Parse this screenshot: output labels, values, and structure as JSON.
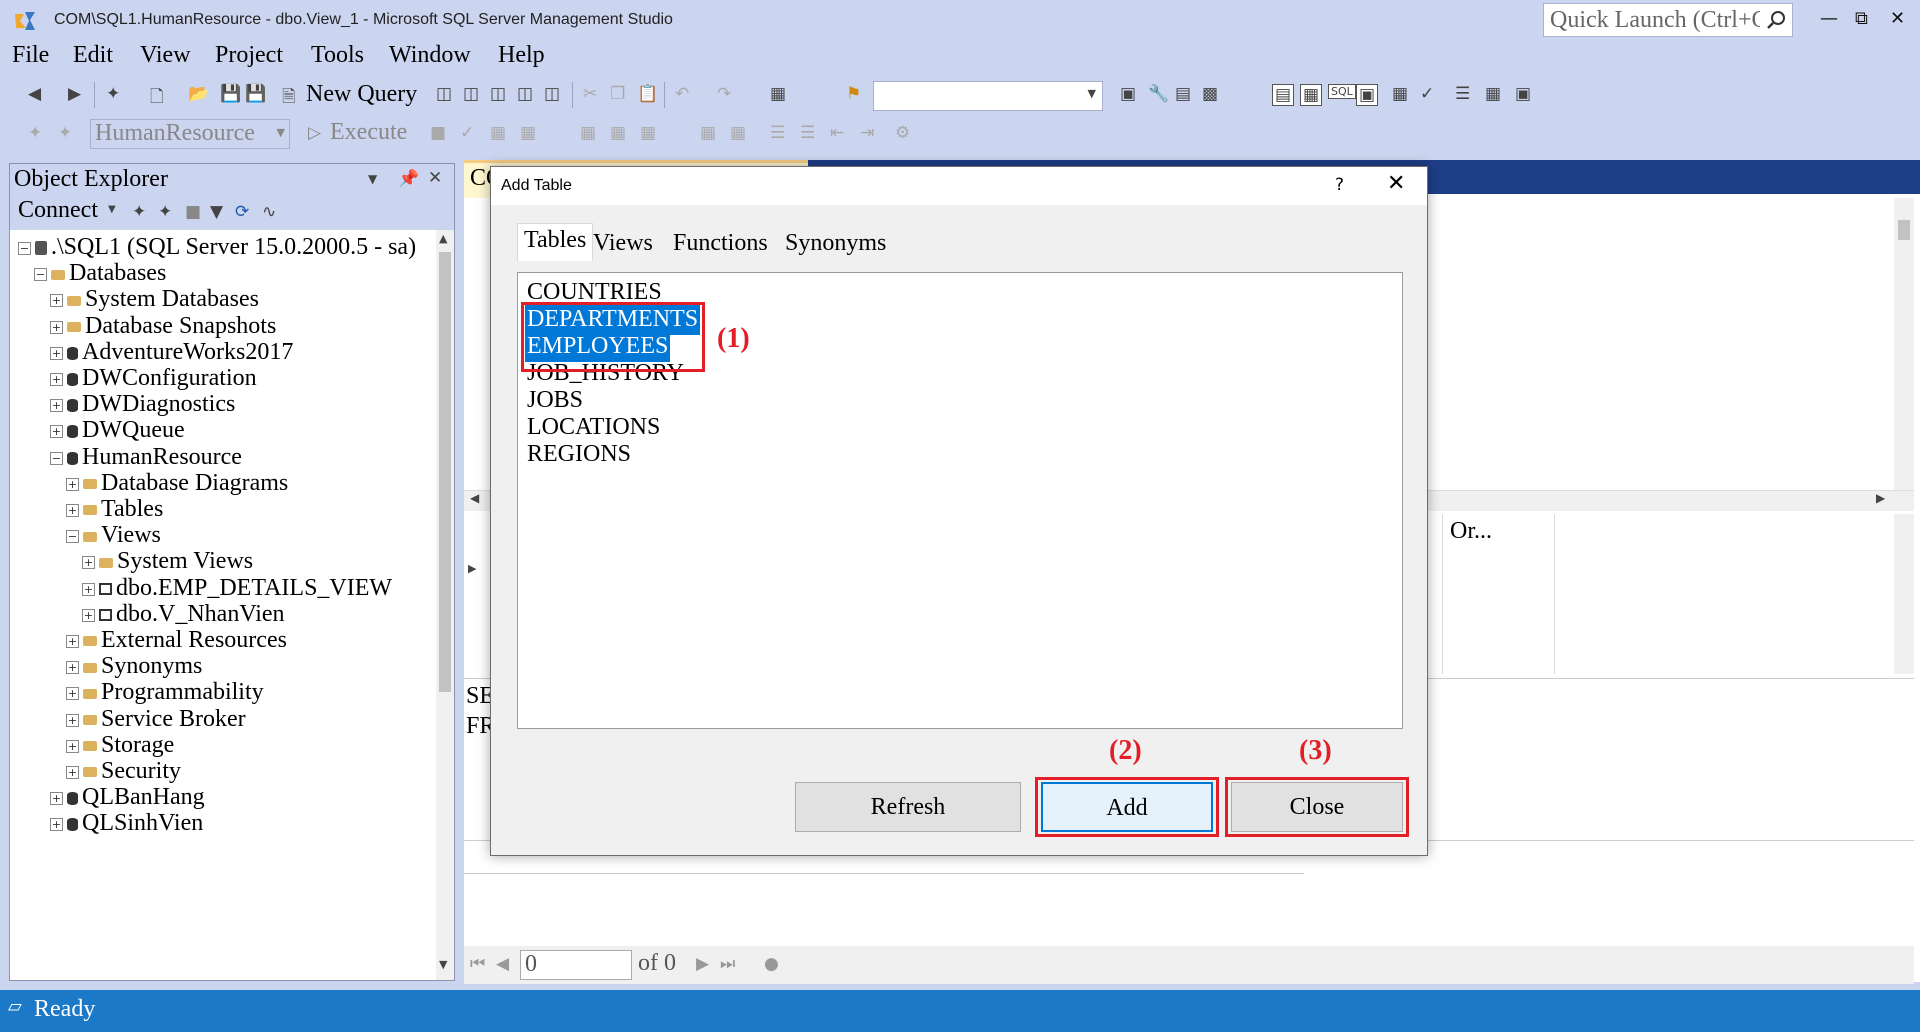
{
  "window": {
    "title": "COM\\SQL1.HumanResource - dbo.View_1 - Microsoft SQL Server Management Studio",
    "quick_launch_placeholder": "Quick Launch (Ctrl+Q)"
  },
  "menu": [
    "File",
    "Edit",
    "View",
    "Project",
    "Tools",
    "Window",
    "Help"
  ],
  "toolbar": {
    "new_query": "New Query",
    "database_select": "HumanResource",
    "execute": "Execute"
  },
  "object_explorer": {
    "title": "Object Explorer",
    "connect": "Connect",
    "tree": [
      {
        "label": ".\\SQL1 (SQL Server 15.0.2000.5 - sa)",
        "level": 0,
        "icon": "server-icon",
        "expanded": true
      },
      {
        "label": "Databases",
        "level": 1,
        "icon": "folder-icon",
        "expanded": true
      },
      {
        "label": "System Databases",
        "level": 2,
        "icon": "folder-icon",
        "expanded": false
      },
      {
        "label": "Database Snapshots",
        "level": 2,
        "icon": "folder-icon",
        "expanded": false
      },
      {
        "label": "AdventureWorks2017",
        "level": 2,
        "icon": "database-icon",
        "expanded": false
      },
      {
        "label": "DWConfiguration",
        "level": 2,
        "icon": "database-icon",
        "expanded": false
      },
      {
        "label": "DWDiagnostics",
        "level": 2,
        "icon": "database-icon",
        "expanded": false
      },
      {
        "label": "DWQueue",
        "level": 2,
        "icon": "database-icon",
        "expanded": false
      },
      {
        "label": "HumanResource",
        "level": 2,
        "icon": "database-icon",
        "expanded": true
      },
      {
        "label": "Database Diagrams",
        "level": 3,
        "icon": "folder-icon",
        "expanded": false
      },
      {
        "label": "Tables",
        "level": 3,
        "icon": "folder-icon",
        "expanded": false
      },
      {
        "label": "Views",
        "level": 3,
        "icon": "folder-icon",
        "expanded": true
      },
      {
        "label": "System Views",
        "level": 4,
        "icon": "folder-icon",
        "expanded": false
      },
      {
        "label": "dbo.EMP_DETAILS_VIEW",
        "level": 4,
        "icon": "view-icon",
        "expanded": false
      },
      {
        "label": "dbo.V_NhanVien",
        "level": 4,
        "icon": "view-icon",
        "expanded": false
      },
      {
        "label": "External Resources",
        "level": 3,
        "icon": "folder-icon",
        "expanded": false
      },
      {
        "label": "Synonyms",
        "level": 3,
        "icon": "folder-icon",
        "expanded": false
      },
      {
        "label": "Programmability",
        "level": 3,
        "icon": "folder-icon",
        "expanded": false
      },
      {
        "label": "Service Broker",
        "level": 3,
        "icon": "folder-icon",
        "expanded": false
      },
      {
        "label": "Storage",
        "level": 3,
        "icon": "folder-icon",
        "expanded": false
      },
      {
        "label": "Security",
        "level": 3,
        "icon": "folder-icon",
        "expanded": false
      },
      {
        "label": "QLBanHang",
        "level": 2,
        "icon": "database-icon",
        "expanded": false
      },
      {
        "label": "QLSinhVien",
        "level": 2,
        "icon": "database-icon",
        "expanded": false
      }
    ]
  },
  "document": {
    "tab_label": "CO",
    "grid_column": "Or...",
    "sql_lines": [
      "SE",
      "FR"
    ],
    "pager": {
      "value": "0",
      "of": "of 0"
    }
  },
  "dialog": {
    "title": "Add Table",
    "help": "?",
    "tabs": [
      "Tables",
      "Views",
      "Functions",
      "Synonyms"
    ],
    "items": [
      {
        "label": "COUNTRIES",
        "selected": false
      },
      {
        "label": "DEPARTMENTS",
        "selected": true
      },
      {
        "label": "EMPLOYEES",
        "selected": true
      },
      {
        "label": "JOB_HISTORY",
        "selected": false
      },
      {
        "label": "JOBS",
        "selected": false
      },
      {
        "label": "LOCATIONS",
        "selected": false
      },
      {
        "label": "REGIONS",
        "selected": false
      }
    ],
    "buttons": {
      "refresh": "Refresh",
      "add": "Add",
      "close": "Close"
    },
    "annotations": {
      "step1": "(1)",
      "step2": "(2)",
      "step3": "(3)"
    }
  },
  "status": {
    "text": "Ready"
  },
  "colors": {
    "accent": "#0078d7",
    "annotation": "#e21e26",
    "statusbar": "#1b79c7"
  }
}
